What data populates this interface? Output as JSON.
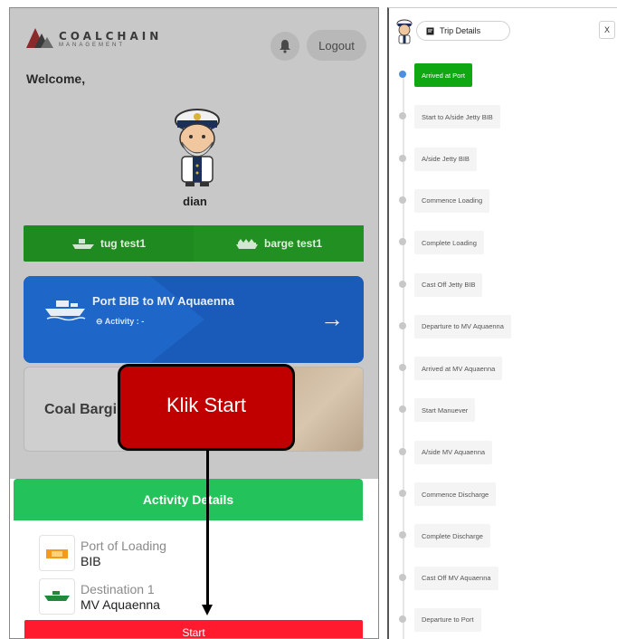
{
  "left_screen": {
    "logo": {
      "line1": "COALCHAIN",
      "line2": "MANAGEMENT"
    },
    "logout_label": "Logout",
    "welcome_text": "Welcome,",
    "username": "dian",
    "tug_label": "tug test1",
    "barge_label": "barge test1",
    "route": {
      "title": "Port BIB to MV Aquaenna",
      "activity": "⊖ Activity : -"
    },
    "barging_label": "Coal Bargin",
    "activity_details": {
      "title": "Activity Details",
      "port_of_loading_label": "Port of Loading",
      "port_of_loading_value": "BIB",
      "destination_label": "Destination 1",
      "destination_value": "MV Aquaenna"
    },
    "start_label": "Start",
    "callout_text": "Klik Start"
  },
  "right_screen": {
    "trip_details_label": "Trip Details",
    "close_label": "X",
    "steps": [
      {
        "label": "Arrived at Port",
        "active": true
      },
      {
        "label": "Start to A/side Jetty BIB",
        "active": false
      },
      {
        "label": "A/side Jetty BIB",
        "active": false
      },
      {
        "label": "Commence Loading",
        "active": false
      },
      {
        "label": "Complete Loading",
        "active": false
      },
      {
        "label": "Cast Off Jetty BIB",
        "active": false
      },
      {
        "label": "Departure to MV Aquaenna",
        "active": false
      },
      {
        "label": "Arrived at MV Aquaenna",
        "active": false
      },
      {
        "label": "Start Manuever",
        "active": false
      },
      {
        "label": "A/side MV Aquaenna",
        "active": false
      },
      {
        "label": "Commence Discharge",
        "active": false
      },
      {
        "label": "Complete Discharge",
        "active": false
      },
      {
        "label": "Cast Off MV Aquaenna",
        "active": false
      },
      {
        "label": "Departure to Port",
        "active": false
      }
    ]
  },
  "icons": [
    "bell-icon",
    "ship-icon",
    "tug-icon",
    "barge-icon",
    "port-icon",
    "vessel-icon",
    "captain-avatar",
    "note-icon"
  ],
  "colors": {
    "green": "#23c25a",
    "step_active": "#0fa812",
    "blue_card": "#1a5ab8",
    "start_red": "#ff1a2e",
    "callout_red": "#c00000"
  }
}
